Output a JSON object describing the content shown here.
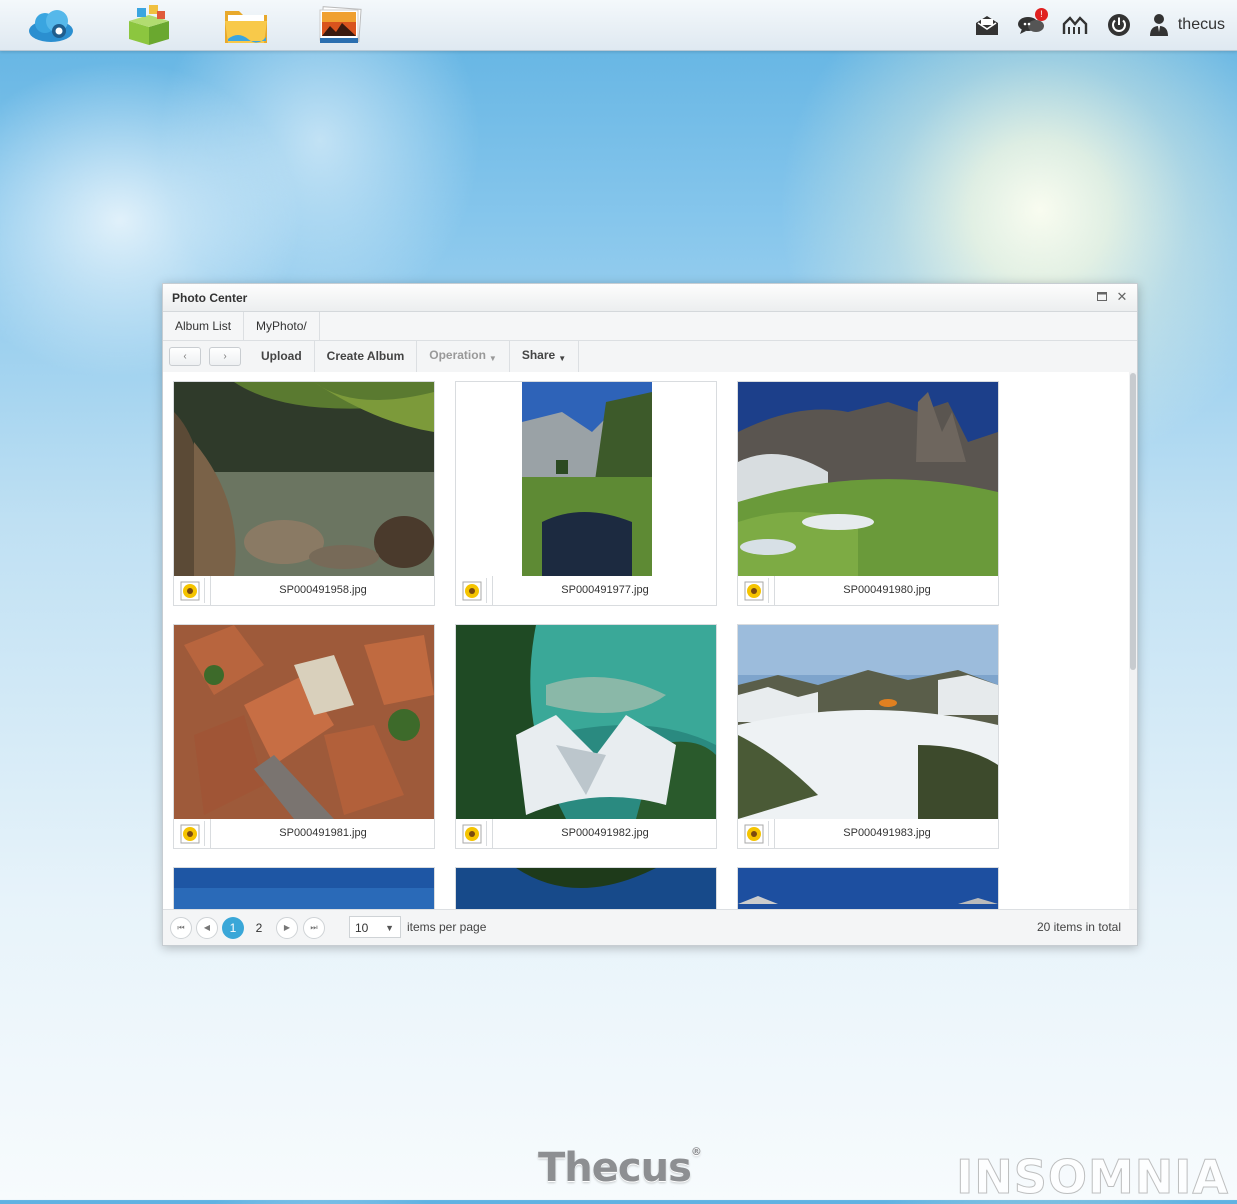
{
  "topbar": {
    "apps": [
      {
        "icon": "cloud-icon"
      },
      {
        "icon": "app-center-box-icon"
      },
      {
        "icon": "folder-icon"
      },
      {
        "icon": "photo-center-icon"
      }
    ],
    "right_icons": [
      {
        "icon": "mail-icon"
      },
      {
        "icon": "chat-icon",
        "badge": "!"
      },
      {
        "icon": "network-icon"
      },
      {
        "icon": "power-icon"
      }
    ],
    "user": "thecus"
  },
  "window": {
    "title": "Photo Center",
    "tabs": [
      "Album List",
      "MyPhoto/"
    ],
    "toolbar": {
      "back": "‹",
      "forward": "›",
      "upload": "Upload",
      "create_album": "Create Album",
      "operation": "Operation",
      "share": "Share"
    },
    "photos": [
      {
        "name": "SP000491958.jpg",
        "scene": "lake-rocks"
      },
      {
        "name": "SP000491977.jpg",
        "scene": "mountain-stream"
      },
      {
        "name": "SP000491980.jpg",
        "scene": "dolomites"
      },
      {
        "name": "SP000491981.jpg",
        "scene": "town-roofs"
      },
      {
        "name": "SP000491982.jpg",
        "scene": "chalk-cliffs"
      },
      {
        "name": "SP000491983.jpg",
        "scene": "snow-valley"
      },
      {
        "name": "",
        "scene": "sky"
      },
      {
        "name": "",
        "scene": "forest-sky"
      },
      {
        "name": "",
        "scene": "sky-peaks"
      }
    ],
    "pager": {
      "pages": [
        "1",
        "2"
      ],
      "current_page": "1",
      "per_page": "10",
      "per_page_label": "items per page",
      "total_label": "20 items in total"
    }
  },
  "footer": {
    "logo": "Thecus",
    "watermark": "INSOMNIA"
  },
  "colors": {
    "accent": "#3aa7d8",
    "badge": "#e02020"
  }
}
